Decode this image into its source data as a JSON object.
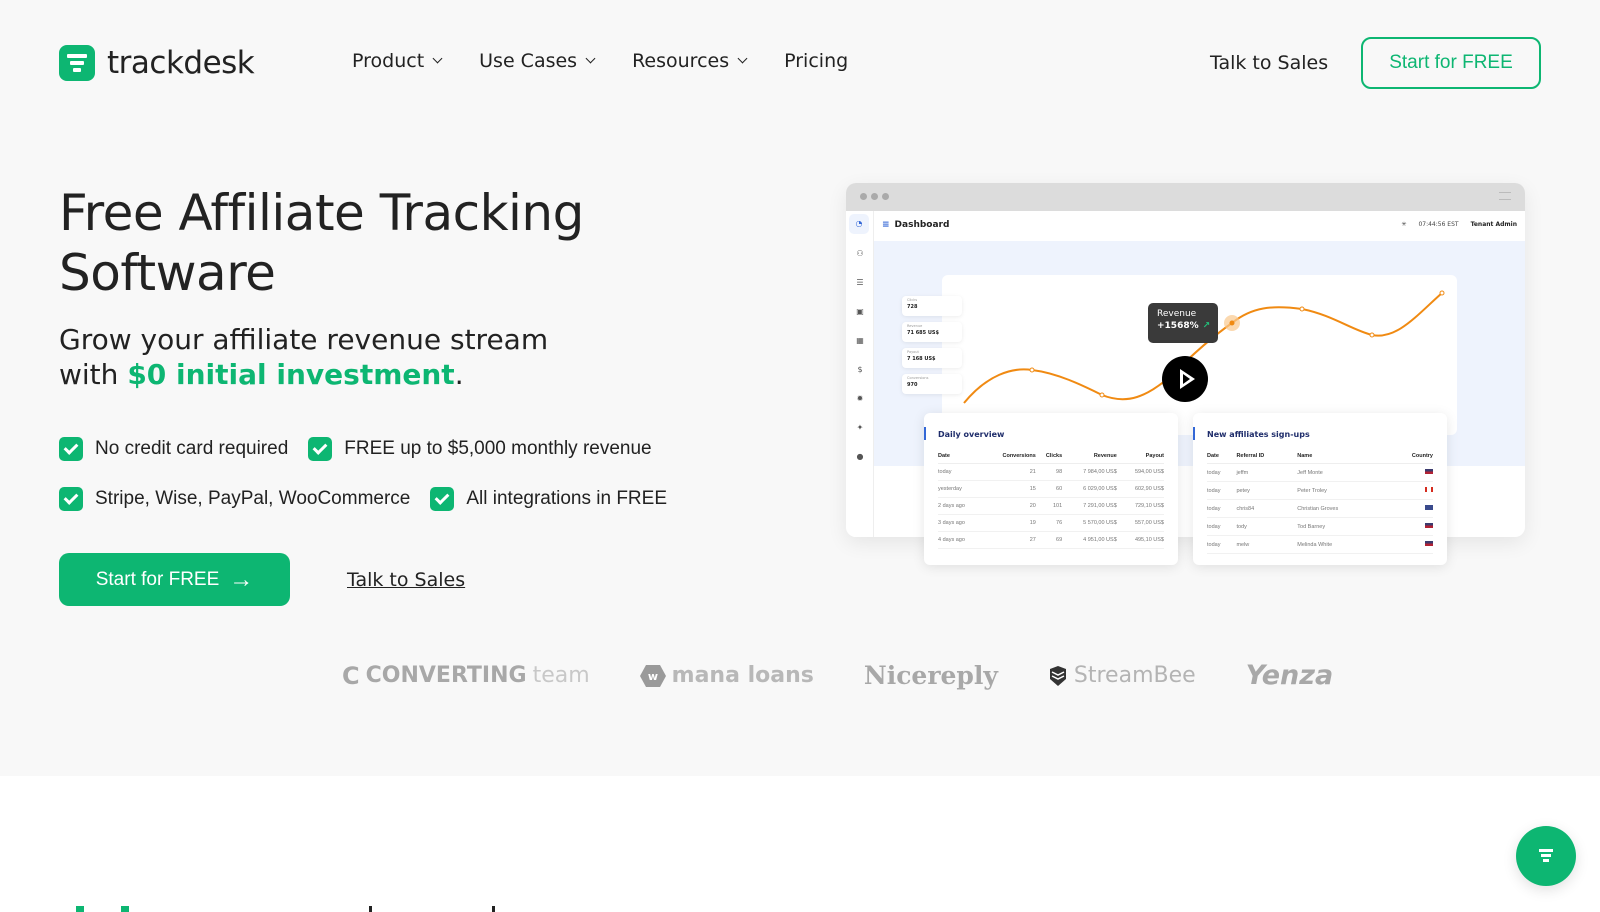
{
  "brand": {
    "name": "trackdesk",
    "accent": "#0db672"
  },
  "nav": {
    "items": [
      {
        "label": "Product",
        "dropdown": true
      },
      {
        "label": "Use Cases",
        "dropdown": true
      },
      {
        "label": "Resources",
        "dropdown": true
      },
      {
        "label": "Pricing",
        "dropdown": false
      }
    ],
    "talk_to_sales": "Talk to Sales",
    "start_free": "Start for FREE"
  },
  "hero": {
    "title_line1": "Free Affiliate Tracking",
    "title_line2": "Software",
    "subtitle_line1": "Grow your affiliate revenue stream",
    "subtitle_prefix": "with ",
    "subtitle_accent": "$0 initial investment",
    "subtitle_suffix": ".",
    "features": [
      "No credit card required",
      "FREE up to $5,000 monthly revenue",
      "Stripe, Wise, PayPal, WooCommerce",
      "All integrations in FREE"
    ],
    "cta_label": "Start for FREE",
    "cta_icon": "arrow-right-icon",
    "secondary_link": "Talk to Sales"
  },
  "customer_logos": [
    {
      "name": "CONVERTING",
      "suffix": "team"
    },
    {
      "name": "mana loans"
    },
    {
      "name": "Nicereply"
    },
    {
      "name": "StreamBee"
    },
    {
      "name": "Yenza"
    }
  ],
  "dashboard_preview": {
    "title": "Dashboard",
    "time": "07:44:56 EST",
    "user": "Tenant Admin",
    "sidebar_icons": [
      "dashboard-icon",
      "users-icon",
      "list-icon",
      "bus-icon",
      "calendar-icon",
      "dollar-icon",
      "gear-icon",
      "bolt-icon",
      "info-icon"
    ],
    "stats": [
      {
        "label": "Clicks",
        "value": "728"
      },
      {
        "label": "Revenue",
        "value": "71 685 US$"
      },
      {
        "label": "Payout",
        "value": "7 168 US$"
      },
      {
        "label": "Conversions",
        "value": "970"
      }
    ],
    "tooltip": {
      "label": "Revenue",
      "value": "+1568%"
    },
    "daily_overview": {
      "title": "Daily overview",
      "columns": [
        "Date",
        "Conversions",
        "Clicks",
        "Revenue",
        "Payout"
      ],
      "rows": [
        [
          "today",
          "21",
          "98",
          "7 984,00 US$",
          "594,00 US$"
        ],
        [
          "yesterday",
          "15",
          "60",
          "6 029,00 US$",
          "602,90 US$"
        ],
        [
          "2 days ago",
          "20",
          "101",
          "7 291,00 US$",
          "729,10 US$"
        ],
        [
          "3 days ago",
          "19",
          "76",
          "5 570,00 US$",
          "557,00 US$"
        ],
        [
          "4 days ago",
          "27",
          "69",
          "4 951,00 US$",
          "495,10 US$"
        ]
      ]
    },
    "new_signups": {
      "title": "New affiliates sign-ups",
      "columns": [
        "Date",
        "Referral ID",
        "Name",
        "Country"
      ],
      "rows": [
        [
          "today",
          "jeffm",
          "Jeff Monte",
          "US"
        ],
        [
          "today",
          "petey",
          "Peter Troley",
          "CA"
        ],
        [
          "today",
          "chris84",
          "Christian Groves",
          "UK"
        ],
        [
          "today",
          "tody",
          "Tod Barney",
          "US"
        ],
        [
          "today",
          "melw",
          "Melinda White",
          "US"
        ]
      ]
    }
  },
  "chat_button": {
    "icon": "trackdesk-logo-icon"
  }
}
